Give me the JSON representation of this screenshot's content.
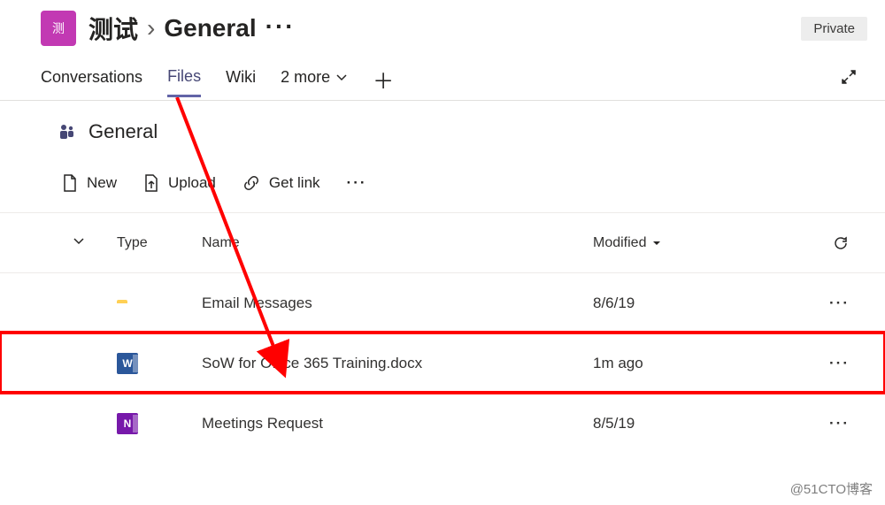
{
  "header": {
    "team_avatar_text": "测",
    "team_name": "测试",
    "channel_name": "General",
    "privacy_label": "Private"
  },
  "tabs": {
    "conversations": "Conversations",
    "files": "Files",
    "wiki": "Wiki",
    "more": "2 more"
  },
  "channel": {
    "title": "General"
  },
  "toolbar": {
    "new": "New",
    "upload": "Upload",
    "get_link": "Get link"
  },
  "columns": {
    "type": "Type",
    "name": "Name",
    "modified": "Modified"
  },
  "rows": [
    {
      "kind": "folder",
      "name": "Email Messages",
      "modified": "8/6/19"
    },
    {
      "kind": "word",
      "name": "SoW for Office 365 Training.docx",
      "modified": "1m ago"
    },
    {
      "kind": "onenote",
      "name": "Meetings Request",
      "modified": "8/5/19"
    }
  ],
  "watermark": "@51CTO博客"
}
